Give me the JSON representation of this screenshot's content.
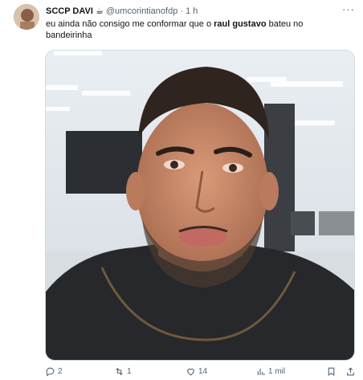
{
  "tweet": {
    "display_name": "SCCP DAVI",
    "name_emoji": "☕",
    "handle": "@umcorintianofdp",
    "separator": "·",
    "time": "1 h",
    "more": "···",
    "text_part1": "eu ainda não consigo me conformar que o ",
    "text_bold": "raul gustavo",
    "text_part2": " bateu no bandeirinha",
    "media_alt": "image"
  },
  "actions": {
    "replies": "2",
    "retweets": "1",
    "likes": "14",
    "views": "1 mil"
  },
  "icons": [
    "reply-icon",
    "retweet-icon",
    "like-icon",
    "views-icon",
    "bookmark-icon",
    "share-icon",
    "more-icon"
  ]
}
